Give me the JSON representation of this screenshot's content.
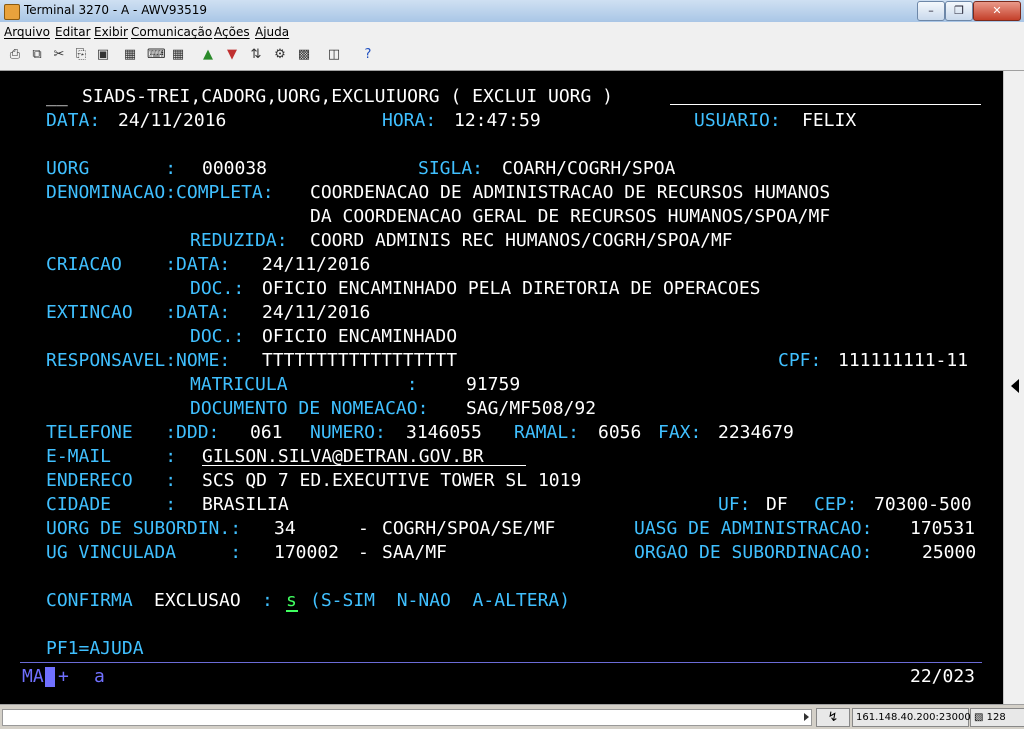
{
  "window": {
    "title": "Terminal 3270 - A - AWV93519"
  },
  "menu": [
    "Arquivo",
    "Editar",
    "Exibir",
    "Comunicação",
    "Ações",
    "Ajuda"
  ],
  "toolbar": [
    "print-icon",
    "copy-icon",
    "cut-icon",
    "paste-icon",
    "paste-special-icon",
    "macro-icon",
    "keyboard-icon",
    "send-icon",
    "receive-icon",
    "transfer-icon",
    "display-icon",
    "settings-icon",
    "help-icon"
  ],
  "colors": {
    "screen_bg": "#000000",
    "field_label": "#40c0ff",
    "field_value": "#ffffff",
    "input": "#40ff60"
  },
  "terminal": {
    "header": "SIADS-TREI,CADORG,UORG,EXCLUIUORG ( EXCLUI UORG )",
    "data_label": "DATA:",
    "data_value": "24/11/2016",
    "hora_label": "HORA:",
    "hora_value": "12:47:59",
    "usuario_label": "USUARIO:",
    "usuario_value": "FELIX",
    "uorg_label": "UORG       :",
    "uorg_value": "000038",
    "sigla_label": "SIGLA:",
    "sigla_value": "COARH/COGRH/SPOA",
    "denominacao_label": "DENOMINACAO:COMPLETA:",
    "completa_1": "COORDENACAO DE ADMINISTRACAO DE RECURSOS HUMANOS",
    "completa_2": "DA COORDENACAO GERAL DE RECURSOS HUMANOS/SPOA/MF",
    "reduzida_label": "REDUZIDA:",
    "reduzida_value": "COORD ADMINIS REC HUMANOS/COGRH/SPOA/MF",
    "criacao_label": "CRIACAO    :DATA:",
    "criacao_data": "24/11/2016",
    "criacao_doc_label": "DOC.:",
    "criacao_doc": "OFICIO ENCAMINHADO PELA DIRETORIA DE OPERACOES",
    "extincao_label": "EXTINCAO   :DATA:",
    "extincao_data": "24/11/2016",
    "extincao_doc_label": "DOC.:",
    "extincao_doc": "OFICIO ENCAMINHADO",
    "responsavel_label": "RESPONSAVEL:NOME:",
    "responsavel_nome": "TTTTTTTTTTTTTTTTTT",
    "cpf_label": "CPF:",
    "cpf_value": "111111111-11",
    "matricula_label": "MATRICULA           :",
    "matricula_value": "91759",
    "nomeacao_label": "DOCUMENTO DE NOMEACAO:",
    "nomeacao_value": "SAG/MF508/92",
    "telefone_label": "TELEFONE   :DDD:",
    "ddd_value": "061",
    "numero_label": "NUMERO:",
    "numero_value": "3146055",
    "ramal_label": "RAMAL:",
    "ramal_value": "6056",
    "fax_label": "FAX:",
    "fax_value": "2234679",
    "email_label": "E-MAIL     :",
    "email_value": "GILSON.SILVA@DETRAN.GOV.BR",
    "endereco_label": "ENDERECO   :",
    "endereco_value": "SCS QD 7 ED.EXECUTIVE TOWER SL 1019",
    "cidade_label": "CIDADE     :",
    "cidade_value": "BRASILIA",
    "uf_label": "UF:",
    "uf_value": "DF",
    "cep_label": "CEP:",
    "cep_value": "70300-500",
    "subordin_label": "UORG DE SUBORDIN.:",
    "subordin_code": "34",
    "subordin_dash": "-",
    "subordin_value": "COGRH/SPOA/SE/MF",
    "uasg_label": "UASG DE ADMINISTRACAO:",
    "uasg_value": "170531",
    "ug_label": "UG VINCULADA     :",
    "ug_code": "170002",
    "ug_dash": "-",
    "ug_value": "SAA/MF",
    "orgao_label": "ORGAO DE SUBORDINACAO:",
    "orgao_value": "25000",
    "confirma_label": "CONFIRMA",
    "exclusao_label": "EXCLUSAO",
    "confirma_colon": ":",
    "confirma_input": "s",
    "confirma_options": "(S-SIM  N-NAO  A-ALTERA)",
    "pf1": "PF1=AJUDA"
  },
  "oia": {
    "mode": "MA",
    "plus": "+",
    "a": "a",
    "cursor_pos": "22/023"
  },
  "status": {
    "host": "161.148.40.200:23000",
    "session": "128"
  }
}
